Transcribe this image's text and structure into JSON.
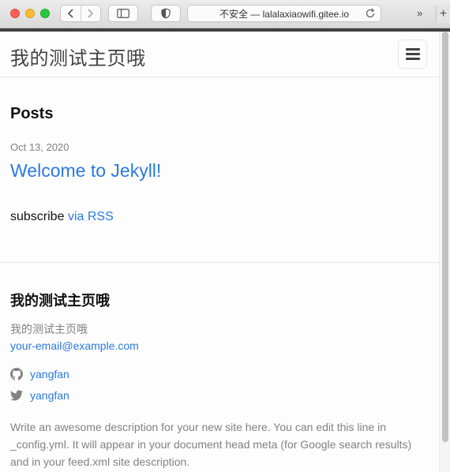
{
  "browser": {
    "address": "不安全 — lalalaxiaowifi.gitee.io",
    "more_tabs_glyph": "»",
    "new_tab_glyph": "+",
    "icons": [
      "back-icon",
      "forward-icon",
      "sidebar-icon",
      "shield-icon",
      "reload-icon"
    ]
  },
  "header": {
    "site_title": "我的测试主页哦",
    "menu_icon": "hamburger-menu-icon"
  },
  "main": {
    "posts_heading": "Posts",
    "posts": [
      {
        "date": "Oct 13, 2020",
        "title": "Welcome to Jekyll!"
      }
    ],
    "subscribe_text": "subscribe",
    "rss_label": "via RSS"
  },
  "footer": {
    "title": "我的测试主页哦",
    "name": "我的测试主页哦",
    "email": "your-email@example.com",
    "github_username": "yangfan",
    "twitter_username": "yangfan",
    "description": "Write an awesome description for your new site here. You can edit this line in _config.yml. It will appear in your document head meta (for Google search results) and in your feed.xml site description."
  },
  "colors": {
    "link": "#2a7ae2",
    "muted": "#828282",
    "text": "#111111",
    "header_bar": "#424242"
  }
}
